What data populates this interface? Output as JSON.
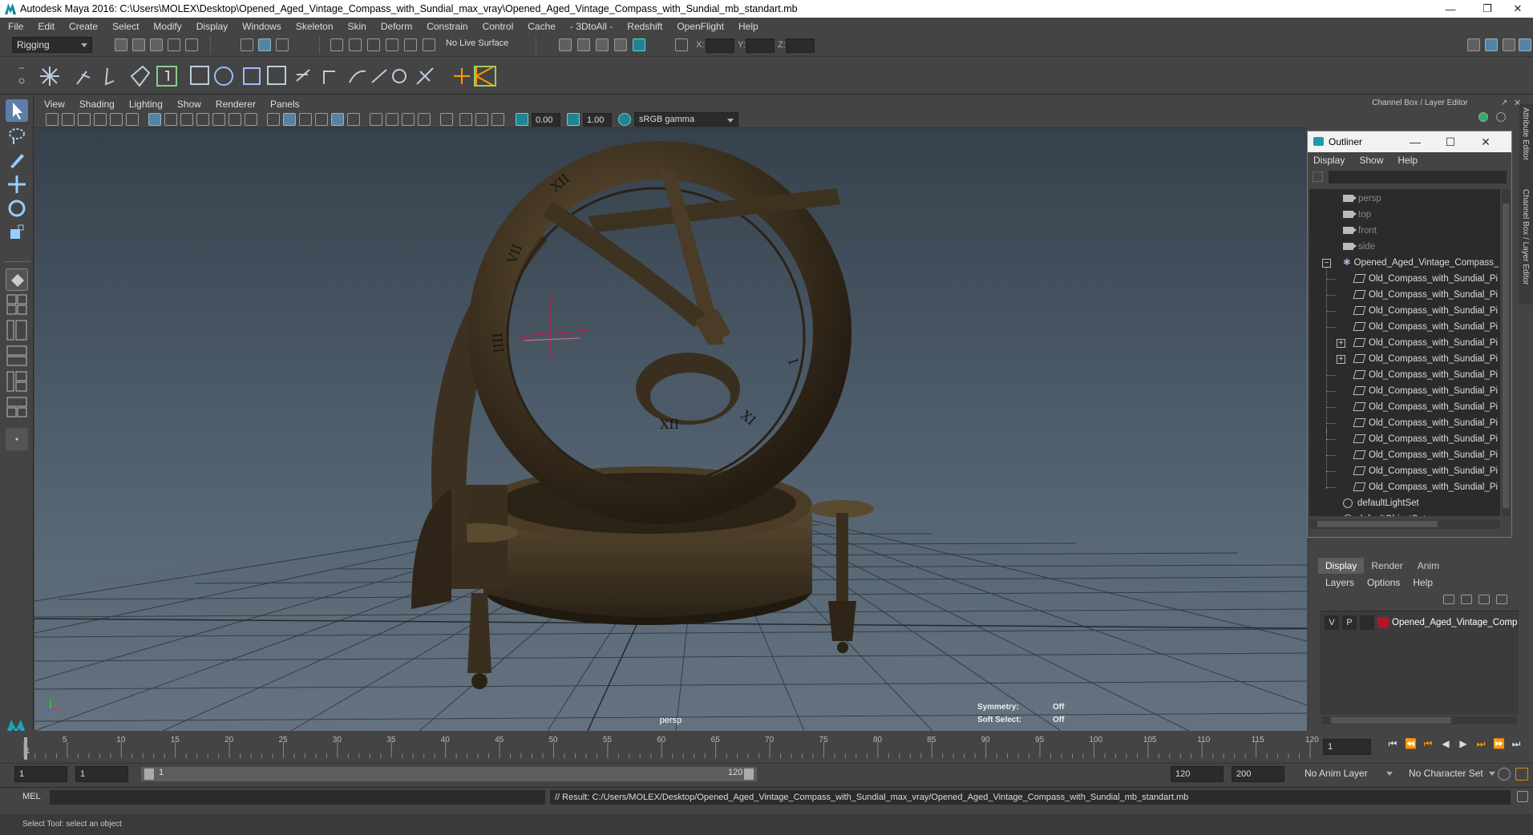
{
  "window": {
    "title": "Autodesk Maya 2016: C:\\Users\\MOLEX\\Desktop\\Opened_Aged_Vintage_Compass_with_Sundial_max_vray\\Opened_Aged_Vintage_Compass_with_Sundial_mb_standart.mb",
    "minimize": "—",
    "restore": "❐",
    "close": "✕"
  },
  "menubar": [
    "File",
    "Edit",
    "Create",
    "Select",
    "Modify",
    "Display",
    "Windows",
    "Skeleton",
    "Skin",
    "Deform",
    "Constrain",
    "Control",
    "Cache",
    "- 3DtoAll -",
    "Redshift",
    "OpenFlight",
    "Help"
  ],
  "status_line": {
    "menuset": "Rigging",
    "live_surface": "No Live Surface",
    "x_label": "X:",
    "y_label": "Y:",
    "z_label": "Z:"
  },
  "viewport": {
    "menu": [
      "View",
      "Shading",
      "Lighting",
      "Show",
      "Renderer",
      "Panels"
    ],
    "near_value": "0.00",
    "far_value": "1.00",
    "color_space": "sRGB gamma",
    "camera_label": "persp",
    "symmetry_label": "Symmetry:",
    "symmetry_value": "Off",
    "soft_select_label": "Soft Select:",
    "soft_select_value": "Off"
  },
  "channel_box": {
    "title": "Channel Box / Layer Editor",
    "side_tabs": [
      "Attribute Editor",
      "Channel Box / Layer Editor"
    ]
  },
  "outliner": {
    "title": "Outliner",
    "minimize": "—",
    "maximize": "☐",
    "close": "✕",
    "menu": [
      "Display",
      "Show",
      "Help"
    ],
    "cameras": [
      "persp",
      "top",
      "front",
      "side"
    ],
    "group": "Opened_Aged_Vintage_Compass_",
    "child_label": "Old_Compass_with_Sundial_Pi",
    "children": [
      {
        "label": "Old_Compass_with_Sundial_Pi",
        "expandable": false
      },
      {
        "label": "Old_Compass_with_Sundial_Pi",
        "expandable": false
      },
      {
        "label": "Old_Compass_with_Sundial_Pi",
        "expandable": false
      },
      {
        "label": "Old_Compass_with_Sundial_Pi",
        "expandable": false
      },
      {
        "label": "Old_Compass_with_Sundial_Pi",
        "expandable": true
      },
      {
        "label": "Old_Compass_with_Sundial_Pi",
        "expandable": true
      },
      {
        "label": "Old_Compass_with_Sundial_Pi",
        "expandable": false
      },
      {
        "label": "Old_Compass_with_Sundial_Pi",
        "expandable": false
      },
      {
        "label": "Old_Compass_with_Sundial_Pi",
        "expandable": false
      },
      {
        "label": "Old_Compass_with_Sundial_Pi",
        "expandable": false
      },
      {
        "label": "Old_Compass_with_Sundial_Pi",
        "expandable": false
      },
      {
        "label": "Old_Compass_with_Sundial_Pi",
        "expandable": false
      },
      {
        "label": "Old_Compass_with_Sundial_Pi",
        "expandable": false
      },
      {
        "label": "Old_Compass_with_Sundial_Pi",
        "expandable": false
      }
    ],
    "sets": [
      "defaultLightSet",
      "defaultObjectSet"
    ]
  },
  "layer_editor": {
    "tabs": [
      "Display",
      "Render",
      "Anim"
    ],
    "active_tab": "Display",
    "menu": [
      "Layers",
      "Options",
      "Help"
    ],
    "layer": {
      "v": "V",
      "p": "P",
      "name": "Opened_Aged_Vintage_Comp",
      "color": "#b0142b"
    }
  },
  "timeline": {
    "labels": [
      "1",
      "5",
      "10",
      "15",
      "20",
      "25",
      "30",
      "35",
      "40",
      "45",
      "50",
      "55",
      "60",
      "65",
      "70",
      "75",
      "80",
      "85",
      "90",
      "95",
      "100",
      "105",
      "110",
      "115",
      "120"
    ],
    "current_frame": "1"
  },
  "range": {
    "start": "1",
    "playback_start": "1",
    "slider_start": "1",
    "slider_end": "120",
    "playback_end": "120",
    "end": "200",
    "anim_layer": "No Anim Layer",
    "character_set": "No Character Set"
  },
  "command_line": {
    "language": "MEL",
    "result": "// Result: C:/Users/MOLEX/Desktop/Opened_Aged_Vintage_Compass_with_Sundial_max_vray/Opened_Aged_Vintage_Compass_with_Sundial_mb_standart.mb"
  },
  "help_line": "Select Tool: select an object",
  "colors": {
    "accent": "#1d9ab0",
    "layer": "#b0142b",
    "manipulator": "#c4184a"
  }
}
